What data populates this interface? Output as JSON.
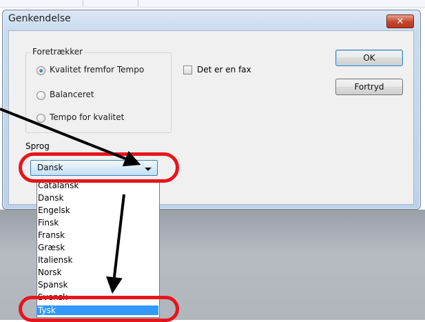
{
  "dialog": {
    "title": "Genkendelse",
    "close_label": "✕"
  },
  "preferences": {
    "legend": "Foretrækker",
    "options": [
      {
        "label": "Kvalitet fremfor Tempo",
        "selected": true
      },
      {
        "label": "Balanceret",
        "selected": false
      },
      {
        "label": "Tempo for kvalitet",
        "selected": false
      }
    ]
  },
  "fax_checkbox": {
    "label": "Det er en fax",
    "checked": false
  },
  "buttons": {
    "ok": "OK",
    "cancel": "Fortryd"
  },
  "language": {
    "label": "Sprog",
    "selected_value": "Dansk",
    "options": [
      "Catalansk",
      "Dansk",
      "Engelsk",
      "Finsk",
      "Fransk",
      "Græsk",
      "Italiensk",
      "Norsk",
      "Spansk",
      "Svensk",
      "Tysk"
    ],
    "highlighted_option": "Tysk"
  },
  "colors": {
    "annotation_red": "#e8141b",
    "selection_blue": "#3399ff",
    "arrow": "#000000"
  }
}
